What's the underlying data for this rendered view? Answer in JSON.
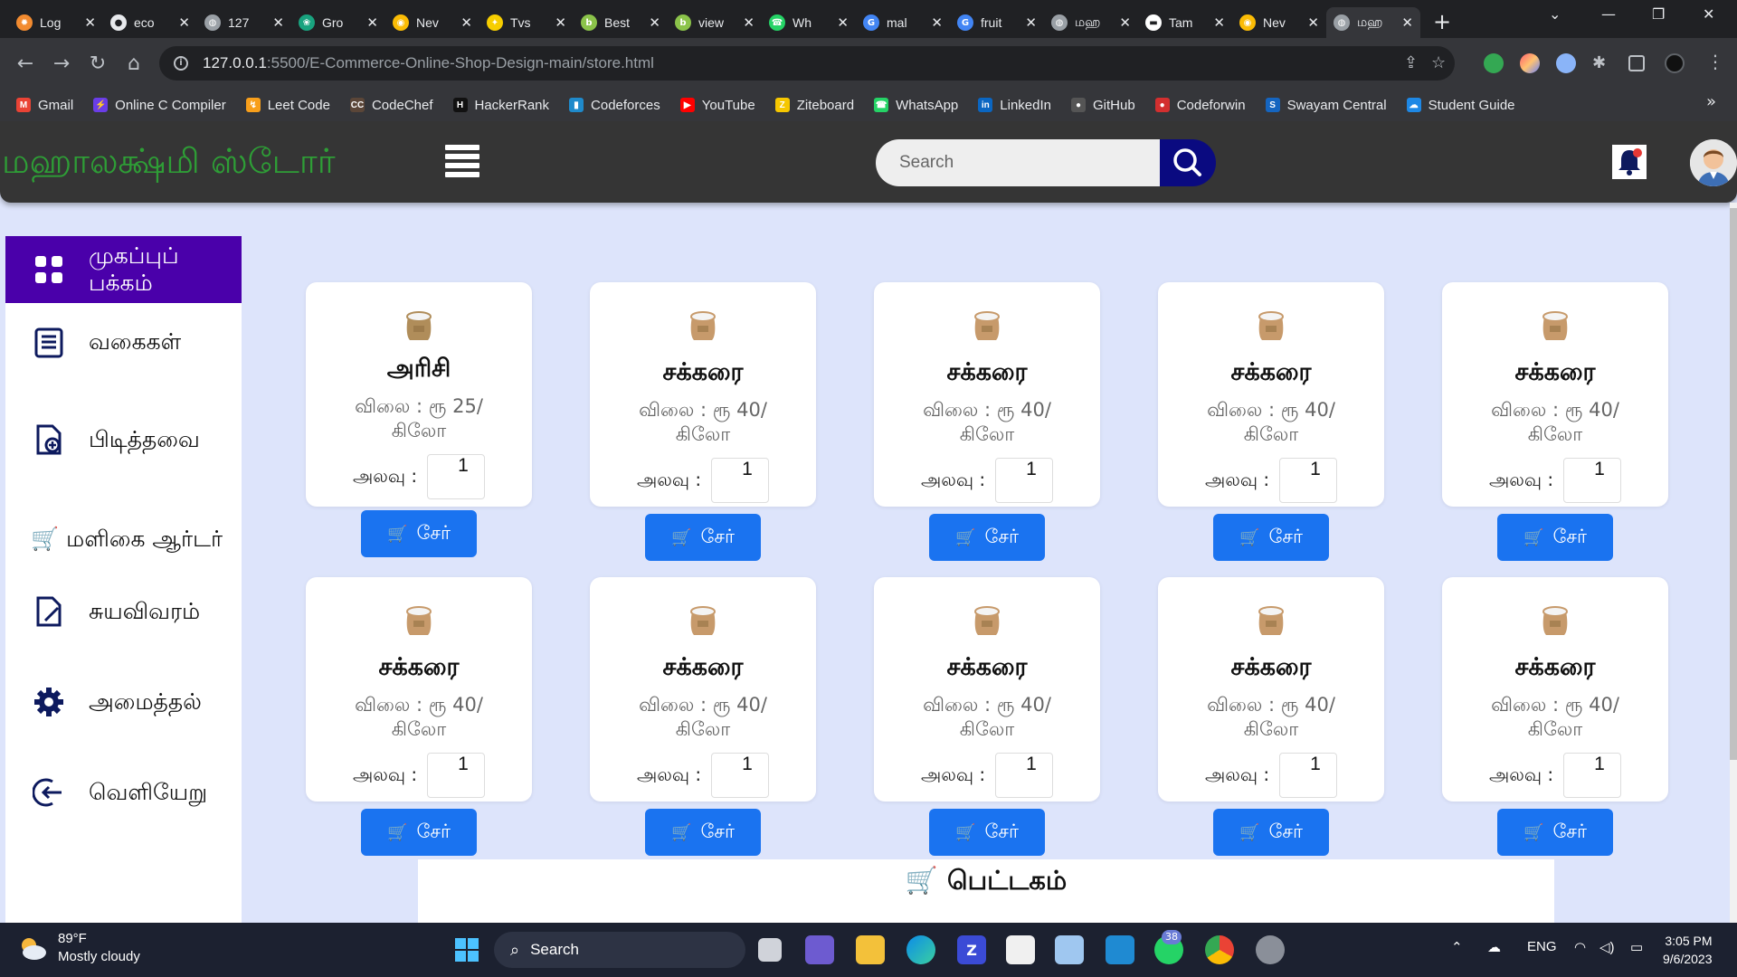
{
  "browser": {
    "tabs": [
      {
        "title": "Log",
        "color": "#f28b30",
        "glyph": "✹"
      },
      {
        "title": "eco",
        "color": "#e8eaed",
        "glyph": "●"
      },
      {
        "title": "127",
        "color": "#9aa0a6",
        "glyph": "◍"
      },
      {
        "title": "Gro",
        "color": "#19a37f",
        "glyph": "❀"
      },
      {
        "title": "Nev",
        "color": "#fbbc05",
        "glyph": "◉"
      },
      {
        "title": "Tvs",
        "color": "#f7ce00",
        "glyph": "✦"
      },
      {
        "title": "Best",
        "color": "#8bc34a",
        "glyph": "b"
      },
      {
        "title": "view",
        "color": "#8bc34a",
        "glyph": "b"
      },
      {
        "title": "Wh",
        "color": "#25d366",
        "glyph": "☎"
      },
      {
        "title": "mal",
        "color": "#4285f4",
        "glyph": "G"
      },
      {
        "title": "fruit",
        "color": "#4285f4",
        "glyph": "G"
      },
      {
        "title": "மஹ",
        "color": "#9aa0a6",
        "glyph": "◍"
      },
      {
        "title": "Tam",
        "color": "#ffffff",
        "glyph": "▬"
      },
      {
        "title": "Nev",
        "color": "#fbbc05",
        "glyph": "◉"
      },
      {
        "title": "மஹ",
        "color": "#9aa0a6",
        "glyph": "◍"
      }
    ],
    "active_tab": 14,
    "url_host": "127.0.0.1",
    "url_path": ":5500/E-Commerce-Online-Shop-Design-main/store.html",
    "bookmarks": [
      {
        "label": "Gmail",
        "color": "#ea4335",
        "glyph": "M"
      },
      {
        "label": "Online C Compiler",
        "color": "#6a3de8",
        "glyph": "⚡"
      },
      {
        "label": "Leet Code",
        "color": "#f89f1b",
        "glyph": "↯"
      },
      {
        "label": "CodeChef",
        "color": "#5b4638",
        "glyph": "CC"
      },
      {
        "label": "HackerRank",
        "color": "#111111",
        "glyph": "H"
      },
      {
        "label": "Codeforces",
        "color": "#1f8acb",
        "glyph": "▮"
      },
      {
        "label": "YouTube",
        "color": "#ff0000",
        "glyph": "▶"
      },
      {
        "label": "Ziteboard",
        "color": "#f6c700",
        "glyph": "Z"
      },
      {
        "label": "WhatsApp",
        "color": "#25d366",
        "glyph": "☎"
      },
      {
        "label": "LinkedIn",
        "color": "#0a66c2",
        "glyph": "in"
      },
      {
        "label": "GitHub",
        "color": "#555555",
        "glyph": "●"
      },
      {
        "label": "Codeforwin",
        "color": "#d32f2f",
        "glyph": "●"
      },
      {
        "label": "Swayam Central",
        "color": "#1565c0",
        "glyph": "S"
      },
      {
        "label": "Student Guide",
        "color": "#1e88e5",
        "glyph": "☁"
      }
    ]
  },
  "site": {
    "logo": "மஹாலக்ஷ்மி ஸ்டோர்",
    "search_placeholder": "Search",
    "sidebar": [
      {
        "label": "முகப்புப் பக்கம்",
        "icon": "dashboard-icon",
        "active": true
      },
      {
        "label": "வகைகள்",
        "icon": "list-icon",
        "active": false
      },
      {
        "label": "பிடித்தவை",
        "icon": "favourite-doc-icon",
        "active": false
      },
      {
        "label": "🛒 மளிகை ஆர்டர்",
        "icon": "cart-icon",
        "active": false
      },
      {
        "label": "சுயவிவரம்",
        "icon": "edit-doc-icon",
        "active": false
      },
      {
        "label": "அமைத்தல்",
        "icon": "gear-icon",
        "active": false
      },
      {
        "label": "வெளியேறு",
        "icon": "logout-icon",
        "active": false
      }
    ],
    "qty_label": "அலவு :",
    "add_label": "சேர்",
    "products": [
      {
        "name": "அரிசி",
        "price": "விலை : ரூ 25/ கிலோ",
        "qty": "1",
        "sack": "#b08d5a"
      },
      {
        "name": "சக்கரை",
        "price": "விலை : ரூ 40/ கிலோ",
        "qty": "1",
        "sack": "#c79a6b"
      },
      {
        "name": "சக்கரை",
        "price": "விலை : ரூ 40/ கிலோ",
        "qty": "1",
        "sack": "#c79a6b"
      },
      {
        "name": "சக்கரை",
        "price": "விலை : ரூ 40/ கிலோ",
        "qty": "1",
        "sack": "#c79a6b"
      },
      {
        "name": "சக்கரை",
        "price": "விலை : ரூ 40/ கிலோ",
        "qty": "1",
        "sack": "#c79a6b"
      },
      {
        "name": "சக்கரை",
        "price": "விலை : ரூ 40/ கிலோ",
        "qty": "1",
        "sack": "#c79a6b"
      },
      {
        "name": "சக்கரை",
        "price": "விலை : ரூ 40/ கிலோ",
        "qty": "1",
        "sack": "#c79a6b"
      },
      {
        "name": "சக்கரை",
        "price": "விலை : ரூ 40/ கிலோ",
        "qty": "1",
        "sack": "#c79a6b"
      },
      {
        "name": "சக்கரை",
        "price": "விலை : ரூ 40/ கிலோ",
        "qty": "1",
        "sack": "#c79a6b"
      },
      {
        "name": "சக்கரை",
        "price": "விலை : ரூ 40/ கிலோ",
        "qty": "1",
        "sack": "#c79a6b"
      }
    ],
    "cart_title": "🛒 பெட்டகம்"
  },
  "taskbar": {
    "temp": "89°F",
    "weather": "Mostly cloudy",
    "search": "Search",
    "lang": "ENG",
    "time": "3:05 PM",
    "date": "9/6/2023",
    "whatsapp_badge": "38"
  },
  "colors": {
    "page_bg": "#dde4fb",
    "header_bg": "#353535",
    "logo": "#2e9e36",
    "sidebar_active": "#4a00aa",
    "button": "#1a73f0",
    "search_button": "#0a0a80"
  }
}
